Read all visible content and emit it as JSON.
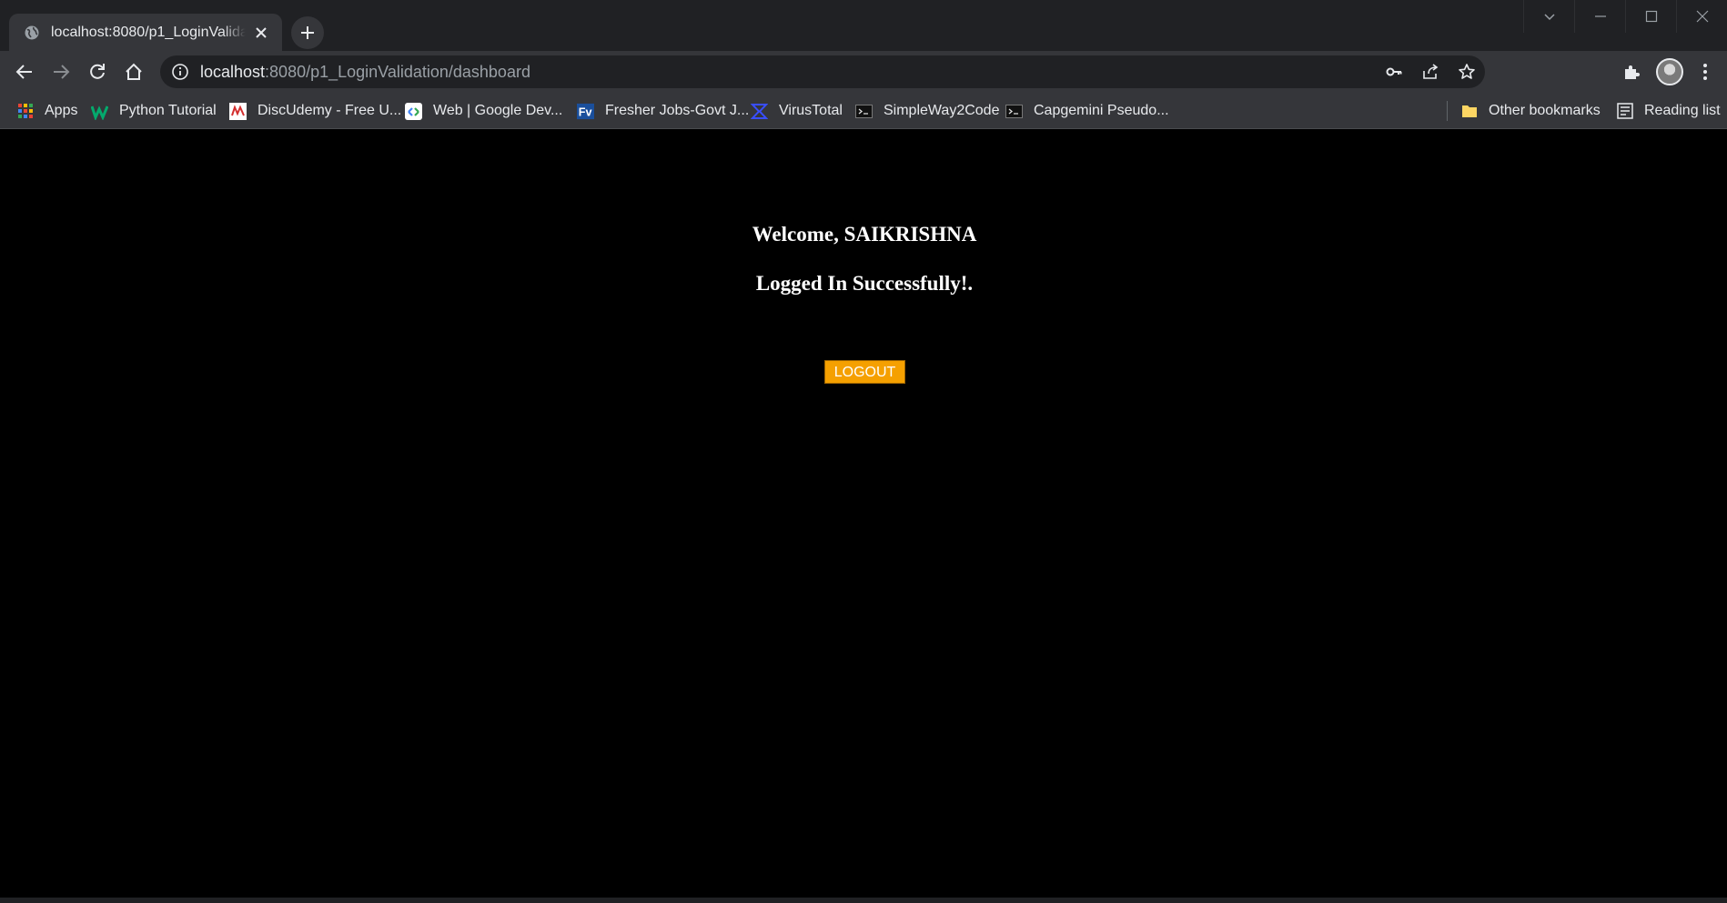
{
  "browser": {
    "tab": {
      "title": "localhost:8080/p1_LoginValidation/dashboard"
    },
    "address_bar": {
      "host": "localhost",
      "rest": ":8080/p1_LoginValidation/dashboard"
    },
    "bookmarks": [
      {
        "label": "Apps",
        "icon": "apps-grid-icon"
      },
      {
        "label": "Python Tutorial",
        "icon": "w3-icon"
      },
      {
        "label": "DiscUdemy - Free U...",
        "icon": "discudemy-icon"
      },
      {
        "label": "Web  |  Google Dev...",
        "icon": "google-dev-icon"
      },
      {
        "label": "Fresher Jobs-Govt J...",
        "icon": "fv-icon"
      },
      {
        "label": "VirusTotal",
        "icon": "virustotal-icon"
      },
      {
        "label": "SimpleWay2Code",
        "icon": "terminal-icon"
      },
      {
        "label": "Capgemini Pseudo...",
        "icon": "terminal-icon"
      }
    ],
    "other_bookmarks": "Other bookmarks",
    "reading_list": "Reading list"
  },
  "page": {
    "welcome": "Welcome, SAIKRISHNA",
    "status": "Logged In Successfully!.",
    "logout_label": "LOGOUT"
  },
  "colors": {
    "background": "#000000",
    "logout_button": "#f5a000",
    "browser_chrome": "#35363a"
  }
}
